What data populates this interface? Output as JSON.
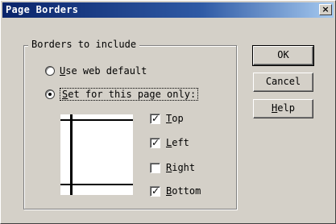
{
  "window": {
    "title": "Page Borders",
    "close_glyph": "×"
  },
  "group": {
    "legend": "Borders to include"
  },
  "radios": [
    {
      "label_prefix": "",
      "label_mnemonic": "U",
      "label_rest": "se web default",
      "selected": false
    },
    {
      "label_prefix": "",
      "label_mnemonic": "S",
      "label_rest": "et for this page only:",
      "selected": true
    }
  ],
  "checkboxes": [
    {
      "label_mnemonic": "T",
      "label_rest": "op",
      "checked": true
    },
    {
      "label_mnemonic": "L",
      "label_rest": "eft",
      "checked": true
    },
    {
      "label_mnemonic": "R",
      "label_rest": "ight",
      "checked": false
    },
    {
      "label_mnemonic": "B",
      "label_rest": "ottom",
      "checked": true
    }
  ],
  "buttons": {
    "ok": "OK",
    "cancel": "Cancel",
    "help_mnemonic": "H",
    "help_rest": "elp"
  },
  "colors": {
    "face": "#d4d0c8",
    "title_start": "#0a246a",
    "title_end": "#a6caf0"
  }
}
